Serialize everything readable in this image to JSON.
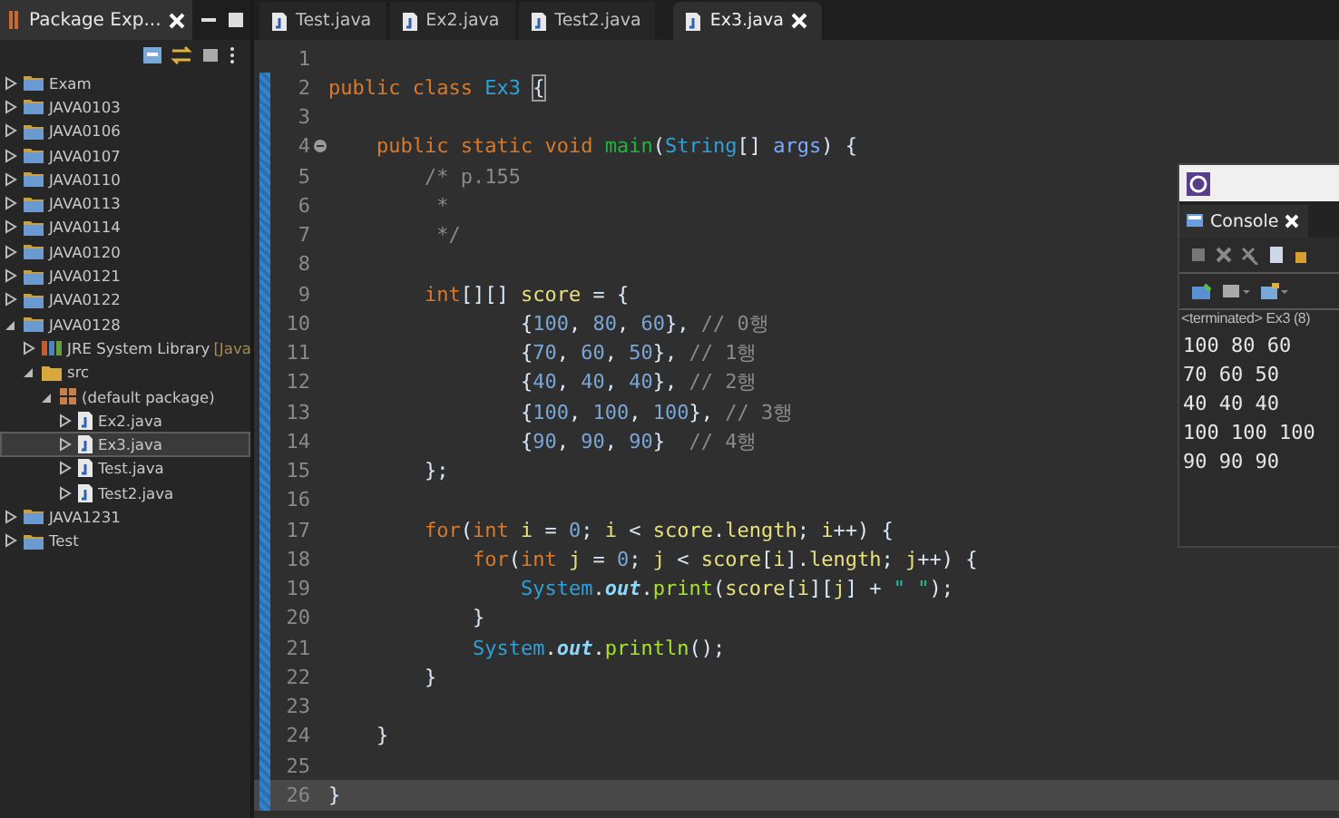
{
  "explorer": {
    "title": "Package Exp...",
    "tree": [
      {
        "label": "Exam",
        "kind": "project",
        "expanded": false,
        "selected": false
      },
      {
        "label": "JAVA0103",
        "kind": "project",
        "expanded": false,
        "selected": false
      },
      {
        "label": "JAVA0106",
        "kind": "project",
        "expanded": false,
        "selected": false
      },
      {
        "label": "JAVA0107",
        "kind": "project",
        "expanded": false,
        "selected": false
      },
      {
        "label": "JAVA0110",
        "kind": "project",
        "expanded": false,
        "selected": false
      },
      {
        "label": "JAVA0113",
        "kind": "project",
        "expanded": false,
        "selected": false
      },
      {
        "label": "JAVA0114",
        "kind": "project",
        "expanded": false,
        "selected": false
      },
      {
        "label": "JAVA0120",
        "kind": "project",
        "expanded": false,
        "selected": false
      },
      {
        "label": "JAVA0121",
        "kind": "project",
        "expanded": false,
        "selected": false
      },
      {
        "label": "JAVA0122",
        "kind": "project",
        "expanded": false,
        "selected": false
      },
      {
        "label": "JAVA0128",
        "kind": "project",
        "expanded": true,
        "selected": false,
        "children": [
          {
            "label": "JRE System Library",
            "decoration": "[Java",
            "kind": "library",
            "expanded": false,
            "selected": false
          },
          {
            "label": "src",
            "kind": "folder",
            "expanded": true,
            "selected": false,
            "children": [
              {
                "label": "(default package)",
                "kind": "package",
                "expanded": true,
                "selected": false,
                "children": [
                  {
                    "label": "Ex2.java",
                    "kind": "java",
                    "expanded": false,
                    "selected": false
                  },
                  {
                    "label": "Ex3.java",
                    "kind": "java",
                    "expanded": false,
                    "selected": true
                  },
                  {
                    "label": "Test.java",
                    "kind": "java",
                    "expanded": false,
                    "selected": false
                  },
                  {
                    "label": "Test2.java",
                    "kind": "java",
                    "expanded": false,
                    "selected": false
                  }
                ]
              }
            ]
          }
        ]
      },
      {
        "label": "JAVA1231",
        "kind": "project",
        "expanded": false,
        "selected": false
      },
      {
        "label": "Test",
        "kind": "project",
        "expanded": false,
        "selected": false
      }
    ]
  },
  "editor": {
    "tabs": [
      {
        "label": "Test.java",
        "selected": false
      },
      {
        "label": "Ex2.java",
        "selected": false
      },
      {
        "label": "Test2.java",
        "selected": false
      },
      {
        "label": "Ex3.java",
        "selected": true
      }
    ],
    "lines": [
      {
        "number": "1",
        "changed": false,
        "current": false,
        "fold": false
      },
      {
        "number": "2",
        "changed": true,
        "current": false,
        "fold": false,
        "tokens": [
          {
            "kind": "kw",
            "text": "public class "
          },
          {
            "kind": "cls",
            "text": "Ex3 "
          },
          {
            "kind": "bracket",
            "text": "{"
          }
        ]
      },
      {
        "number": "3",
        "changed": true,
        "current": false,
        "fold": false
      },
      {
        "number": "4",
        "changed": true,
        "current": false,
        "fold": true,
        "tokens": [
          {
            "kind": "kw",
            "text": "\tpublic static void "
          },
          {
            "kind": "mdecl",
            "text": "main"
          },
          {
            "kind": "plain",
            "text": "("
          },
          {
            "kind": "cls",
            "text": "String"
          },
          {
            "kind": "plain",
            "text": "[] "
          },
          {
            "kind": "param",
            "text": "args"
          },
          {
            "kind": "plain",
            "text": ") {"
          }
        ]
      },
      {
        "number": "5",
        "changed": true,
        "current": false,
        "fold": false,
        "tokens": [
          {
            "kind": "comment",
            "text": "\t\t/* p.155"
          }
        ]
      },
      {
        "number": "6",
        "changed": true,
        "current": false,
        "fold": false,
        "tokens": [
          {
            "kind": "comment",
            "text": "\t\t *"
          }
        ]
      },
      {
        "number": "7",
        "changed": true,
        "current": false,
        "fold": false,
        "tokens": [
          {
            "kind": "comment",
            "text": "\t\t */"
          }
        ]
      },
      {
        "number": "8",
        "changed": true,
        "current": false,
        "fold": false
      },
      {
        "number": "9",
        "changed": true,
        "current": false,
        "fold": false,
        "tokens": [
          {
            "kind": "kw",
            "text": "\t\tint"
          },
          {
            "kind": "plain",
            "text": "[][] "
          },
          {
            "kind": "local",
            "text": "score"
          },
          {
            "kind": "plain",
            "text": " = {"
          }
        ]
      },
      {
        "number": "10",
        "changed": true,
        "current": false,
        "fold": false,
        "tokens": [
          {
            "kind": "plain",
            "text": "\t\t\t\t{"
          },
          {
            "kind": "num",
            "text": "100"
          },
          {
            "kind": "plain",
            "text": ", "
          },
          {
            "kind": "num",
            "text": "80"
          },
          {
            "kind": "plain",
            "text": ", "
          },
          {
            "kind": "num",
            "text": "60"
          },
          {
            "kind": "plain",
            "text": "}, "
          },
          {
            "kind": "comment",
            "text": "// 0행"
          }
        ]
      },
      {
        "number": "11",
        "changed": true,
        "current": false,
        "fold": false,
        "tokens": [
          {
            "kind": "plain",
            "text": "\t\t\t\t{"
          },
          {
            "kind": "num",
            "text": "70"
          },
          {
            "kind": "plain",
            "text": ", "
          },
          {
            "kind": "num",
            "text": "60"
          },
          {
            "kind": "plain",
            "text": ", "
          },
          {
            "kind": "num",
            "text": "50"
          },
          {
            "kind": "plain",
            "text": "}, "
          },
          {
            "kind": "comment",
            "text": "// 1행"
          }
        ]
      },
      {
        "number": "12",
        "changed": true,
        "current": false,
        "fold": false,
        "tokens": [
          {
            "kind": "plain",
            "text": "\t\t\t\t{"
          },
          {
            "kind": "num",
            "text": "40"
          },
          {
            "kind": "plain",
            "text": ", "
          },
          {
            "kind": "num",
            "text": "40"
          },
          {
            "kind": "plain",
            "text": ", "
          },
          {
            "kind": "num",
            "text": "40"
          },
          {
            "kind": "plain",
            "text": "}, "
          },
          {
            "kind": "comment",
            "text": "// 2행"
          }
        ]
      },
      {
        "number": "13",
        "changed": true,
        "current": false,
        "fold": false,
        "tokens": [
          {
            "kind": "plain",
            "text": "\t\t\t\t{"
          },
          {
            "kind": "num",
            "text": "100"
          },
          {
            "kind": "plain",
            "text": ", "
          },
          {
            "kind": "num",
            "text": "100"
          },
          {
            "kind": "plain",
            "text": ", "
          },
          {
            "kind": "num",
            "text": "100"
          },
          {
            "kind": "plain",
            "text": "}, "
          },
          {
            "kind": "comment",
            "text": "// 3행"
          }
        ]
      },
      {
        "number": "14",
        "changed": true,
        "current": false,
        "fold": false,
        "tokens": [
          {
            "kind": "plain",
            "text": "\t\t\t\t{"
          },
          {
            "kind": "num",
            "text": "90"
          },
          {
            "kind": "plain",
            "text": ", "
          },
          {
            "kind": "num",
            "text": "90"
          },
          {
            "kind": "plain",
            "text": ", "
          },
          {
            "kind": "num",
            "text": "90"
          },
          {
            "kind": "plain",
            "text": "}  "
          },
          {
            "kind": "comment",
            "text": "// 4행"
          }
        ]
      },
      {
        "number": "15",
        "changed": true,
        "current": false,
        "fold": false,
        "tokens": [
          {
            "kind": "plain",
            "text": "\t\t};"
          }
        ]
      },
      {
        "number": "16",
        "changed": true,
        "current": false,
        "fold": false
      },
      {
        "number": "17",
        "changed": true,
        "current": false,
        "fold": false,
        "tokens": [
          {
            "kind": "kw",
            "text": "\t\tfor"
          },
          {
            "kind": "plain",
            "text": "("
          },
          {
            "kind": "kw",
            "text": "int "
          },
          {
            "kind": "local",
            "text": "i"
          },
          {
            "kind": "plain",
            "text": " = "
          },
          {
            "kind": "num",
            "text": "0"
          },
          {
            "kind": "plain",
            "text": "; "
          },
          {
            "kind": "local",
            "text": "i"
          },
          {
            "kind": "plain",
            "text": " < "
          },
          {
            "kind": "local",
            "text": "score"
          },
          {
            "kind": "plain",
            "text": "."
          },
          {
            "kind": "local",
            "text": "length"
          },
          {
            "kind": "plain",
            "text": "; "
          },
          {
            "kind": "local",
            "text": "i"
          },
          {
            "kind": "plain",
            "text": "++) {"
          }
        ]
      },
      {
        "number": "18",
        "changed": true,
        "current": false,
        "fold": false,
        "tokens": [
          {
            "kind": "kw",
            "text": "\t\t\tfor"
          },
          {
            "kind": "plain",
            "text": "("
          },
          {
            "kind": "kw",
            "text": "int "
          },
          {
            "kind": "local",
            "text": "j"
          },
          {
            "kind": "plain",
            "text": " = "
          },
          {
            "kind": "num",
            "text": "0"
          },
          {
            "kind": "plain",
            "text": "; "
          },
          {
            "kind": "local",
            "text": "j"
          },
          {
            "kind": "plain",
            "text": " < "
          },
          {
            "kind": "local",
            "text": "score"
          },
          {
            "kind": "plain",
            "text": "["
          },
          {
            "kind": "local",
            "text": "i"
          },
          {
            "kind": "plain",
            "text": "]."
          },
          {
            "kind": "local",
            "text": "length"
          },
          {
            "kind": "plain",
            "text": "; "
          },
          {
            "kind": "local",
            "text": "j"
          },
          {
            "kind": "plain",
            "text": "++) {"
          }
        ]
      },
      {
        "number": "19",
        "changed": true,
        "current": false,
        "fold": false,
        "tokens": [
          {
            "kind": "cls",
            "text": "\t\t\t\tSystem"
          },
          {
            "kind": "plain",
            "text": "."
          },
          {
            "kind": "sfield",
            "text": "out"
          },
          {
            "kind": "plain",
            "text": "."
          },
          {
            "kind": "method",
            "text": "print"
          },
          {
            "kind": "plain",
            "text": "("
          },
          {
            "kind": "local",
            "text": "score"
          },
          {
            "kind": "plain",
            "text": "["
          },
          {
            "kind": "local",
            "text": "i"
          },
          {
            "kind": "plain",
            "text": "]["
          },
          {
            "kind": "local",
            "text": "j"
          },
          {
            "kind": "plain",
            "text": "] + "
          },
          {
            "kind": "str",
            "text": "\" \""
          },
          {
            "kind": "plain",
            "text": ");"
          }
        ]
      },
      {
        "number": "20",
        "changed": true,
        "current": false,
        "fold": false,
        "tokens": [
          {
            "kind": "plain",
            "text": "\t\t\t}"
          }
        ]
      },
      {
        "number": "21",
        "changed": true,
        "current": false,
        "fold": false,
        "tokens": [
          {
            "kind": "cls",
            "text": "\t\t\tSystem"
          },
          {
            "kind": "plain",
            "text": "."
          },
          {
            "kind": "sfield",
            "text": "out"
          },
          {
            "kind": "plain",
            "text": "."
          },
          {
            "kind": "method",
            "text": "println"
          },
          {
            "kind": "plain",
            "text": "();"
          }
        ]
      },
      {
        "number": "22",
        "changed": true,
        "current": false,
        "fold": false,
        "tokens": [
          {
            "kind": "plain",
            "text": "\t\t}"
          }
        ]
      },
      {
        "number": "23",
        "changed": true,
        "current": false,
        "fold": false
      },
      {
        "number": "24",
        "changed": true,
        "current": false,
        "fold": false,
        "tokens": [
          {
            "kind": "plain",
            "text": "\t}"
          }
        ]
      },
      {
        "number": "25",
        "changed": true,
        "current": false,
        "fold": false
      },
      {
        "number": "26",
        "changed": true,
        "current": true,
        "fold": false,
        "tokens": [
          {
            "kind": "plain",
            "text": "}"
          }
        ]
      }
    ]
  },
  "console": {
    "title": "Console",
    "status": "<terminated> Ex3 (8)",
    "output": [
      "100 80 60",
      "70 60 50",
      "40 40 40",
      "100 100 100",
      "90 90 90"
    ]
  }
}
